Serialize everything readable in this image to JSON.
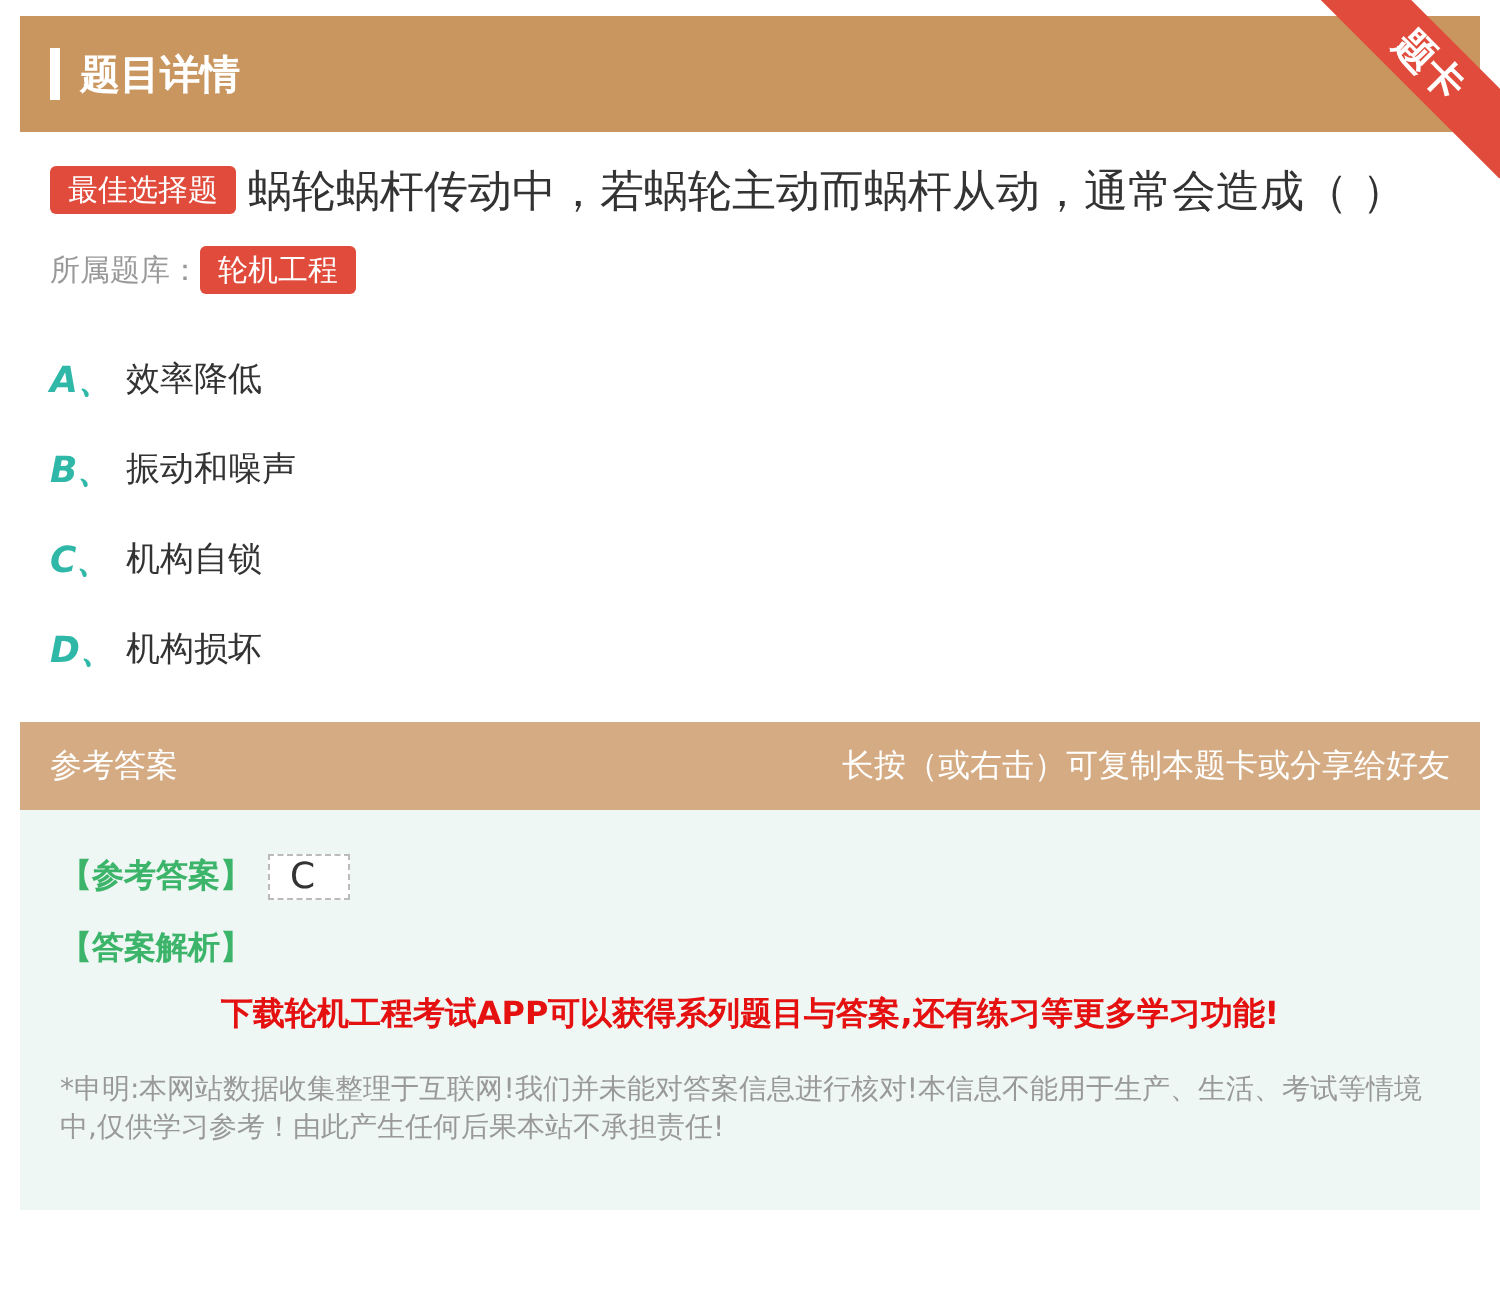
{
  "header": {
    "title": "题目详情",
    "ribbon": "题卡"
  },
  "question": {
    "type_badge": "最佳选择题",
    "text": "蜗轮蜗杆传动中，若蜗轮主动而蜗杆从动，通常会造成（  ）"
  },
  "bank": {
    "label": "所属题库：",
    "tag": "轮机工程"
  },
  "options": [
    {
      "letter": "A、",
      "text": "效率降低"
    },
    {
      "letter": "B、",
      "text": "振动和噪声"
    },
    {
      "letter": "C、",
      "text": "机构自锁"
    },
    {
      "letter": "D、",
      "text": "机构损坏"
    }
  ],
  "answer_bar": {
    "title": "参考答案",
    "hint": "长按（或右击）可复制本题卡或分享给好友"
  },
  "answer": {
    "label": "【参考答案】",
    "value": "C",
    "analysis_label": "【答案解析】",
    "promo": "下载轮机工程考试APP可以获得系列题目与答案,还有练习等更多学习功能!",
    "disclaimer": "*申明:本网站数据收集整理于互联网!我们并未能对答案信息进行核对!本信息不能用于生产、生活、考试等情境中,仅供学习参考！由此产生任何后果本站不承担责任!"
  }
}
